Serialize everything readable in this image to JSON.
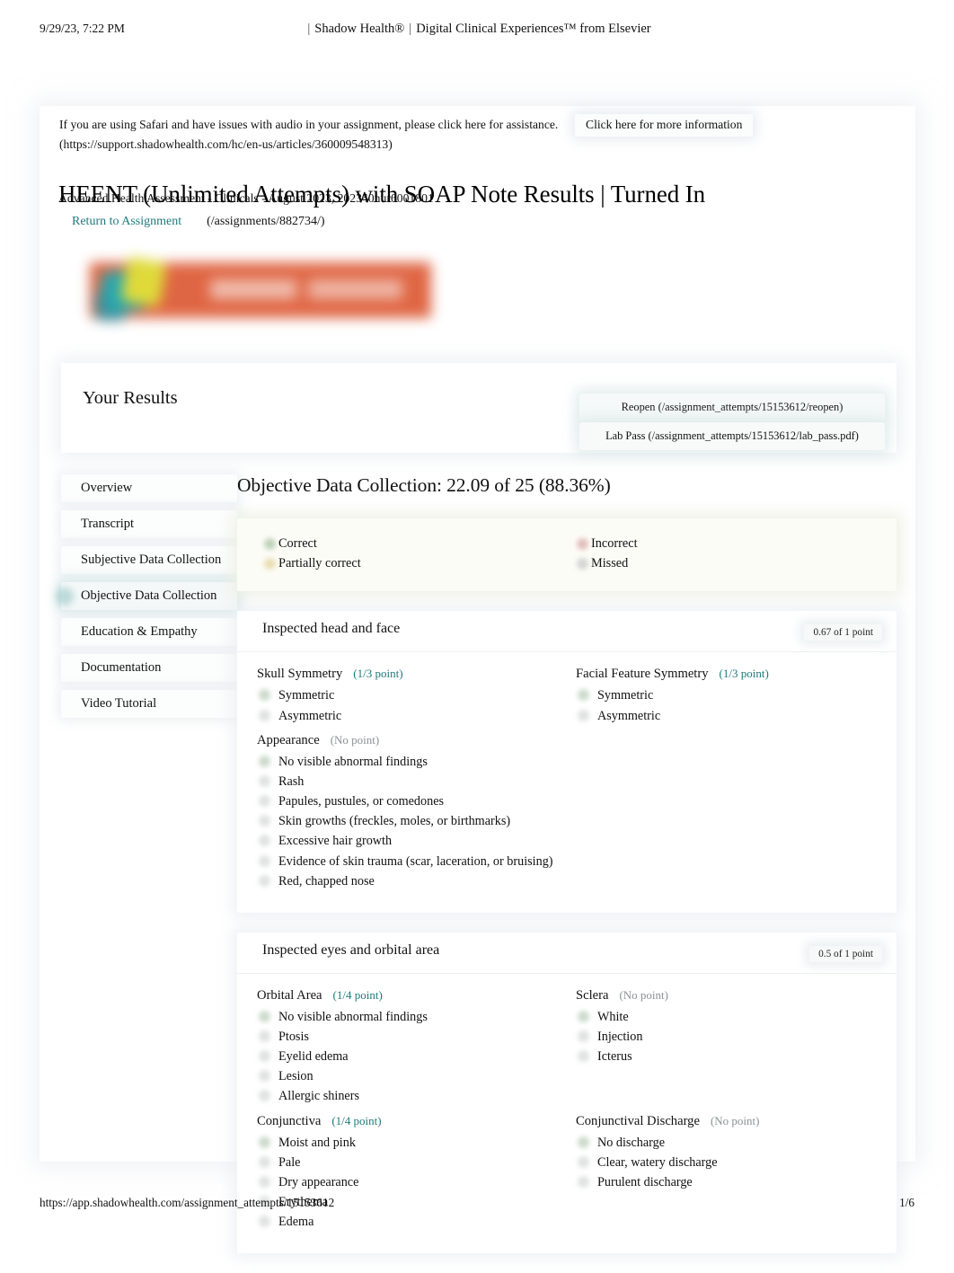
{
  "print_header": {
    "date": "9/29/23, 7:22 PM",
    "brand_left": "Shadow Health®",
    "brand_sep": "|",
    "brand_right": "Digital Clinical Experiences™ from Elsevier"
  },
  "notice": {
    "text": "If you are using Safari and have issues with audio in your assignment, please click here for assistance. (https://support.shadowhealth.com/hc/en-us/articles/360009548313)",
    "more_info_label": "Click here for more information"
  },
  "title": {
    "heading": "HEENT (Unlimited Attempts) with SOAP Note Results | Turned In",
    "subheading": "Advanced Health Assessment - Clinicals - August 2023, 202340nur6001801",
    "return_link": "Return to Assignment",
    "return_url": "(/assignments/882734/)"
  },
  "results": {
    "panel_title": "Your Results",
    "reopen_label": "Reopen (/assignment_attempts/15153612/reopen)",
    "lab_pass_label": "Lab Pass (/assignment_attempts/15153612/lab_pass.pdf)"
  },
  "sidebar": {
    "items": [
      {
        "label": "Overview",
        "active": false
      },
      {
        "label": "Transcript",
        "active": false
      },
      {
        "label": "Subjective Data Collection",
        "active": false
      },
      {
        "label": "Objective Data Collection",
        "active": true
      },
      {
        "label": "Education & Empathy",
        "active": false
      },
      {
        "label": "Documentation",
        "active": false
      },
      {
        "label": "Video Tutorial",
        "active": false
      }
    ]
  },
  "main": {
    "score_heading": "Objective Data Collection: 22.09 of 25 (88.36%)",
    "legend": {
      "left": [
        {
          "label": "Correct",
          "color": "#4f8a4f"
        },
        {
          "label": "Partially correct",
          "color": "#c8a93c"
        }
      ],
      "right": [
        {
          "label": "Incorrect",
          "color": "#b15151"
        },
        {
          "label": "Missed",
          "color": "#8d9294"
        }
      ]
    },
    "sections": [
      {
        "title": "Inspected head and face",
        "points": "0.67 of 1 point",
        "groups": [
          {
            "name": "Skull Symmetry",
            "points": "(1/3 point)",
            "no_point": false,
            "column": "left",
            "options": [
              "Symmetric",
              "Asymmetric"
            ]
          },
          {
            "name": "Facial Feature Symmetry",
            "points": "(1/3 point)",
            "no_point": false,
            "column": "right",
            "options": [
              "Symmetric",
              "Asymmetric"
            ]
          },
          {
            "name": "Appearance",
            "points": "(No point)",
            "no_point": true,
            "column": "full",
            "options": [
              "No visible abnormal findings",
              "Rash",
              "Papules, pustules, or comedones",
              "Skin growths (freckles, moles, or birthmarks)",
              "Excessive hair growth",
              "Evidence of skin trauma (scar, laceration, or bruising)",
              "Red, chapped nose"
            ]
          }
        ]
      },
      {
        "title": "Inspected eyes and orbital area",
        "points": "0.5 of 1 point",
        "groups": [
          {
            "name": "Orbital Area",
            "points": "(1/4 point)",
            "no_point": false,
            "column": "left",
            "options": [
              "No visible abnormal findings",
              "Ptosis",
              "Eyelid edema",
              "Lesion",
              "Allergic shiners"
            ]
          },
          {
            "name": "Sclera",
            "points": "(No point)",
            "no_point": true,
            "column": "right",
            "options": [
              "White",
              "Injection",
              "Icterus"
            ]
          },
          {
            "name": "Conjunctiva",
            "points": "(1/4 point)",
            "no_point": false,
            "column": "left",
            "options": [
              "Moist and pink",
              "Pale",
              "Dry appearance",
              "Erythema",
              "Edema"
            ]
          },
          {
            "name": "Conjunctival Discharge",
            "points": "(No point)",
            "no_point": true,
            "column": "right",
            "options": [
              "No discharge",
              "Clear, watery discharge",
              "Purulent discharge"
            ]
          }
        ]
      }
    ]
  },
  "footer": {
    "url": "https://app.shadowhealth.com/assignment_attempts/15153612",
    "page": "1/6"
  }
}
